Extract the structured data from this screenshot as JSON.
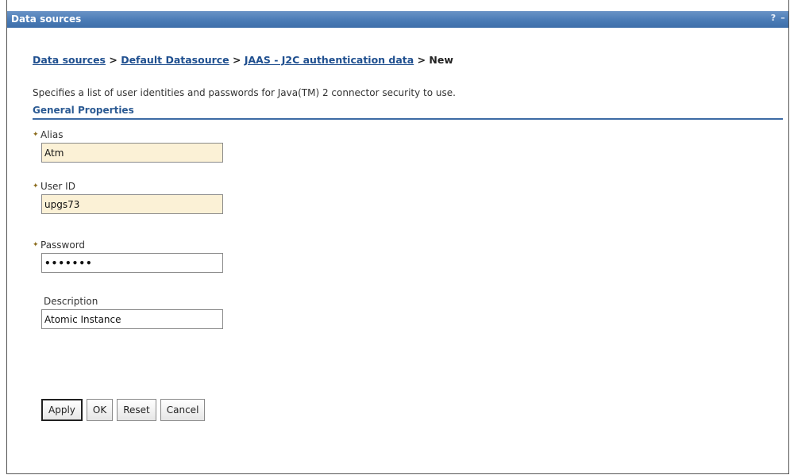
{
  "window": {
    "title": "Data sources",
    "help_icon_glyph": "?",
    "minimize_icon_glyph": "–"
  },
  "breadcrumb": {
    "items": [
      "Data sources",
      "Default Datasource",
      "JAAS - J2C authentication data"
    ],
    "separator": ">",
    "current": "New"
  },
  "description": "Specifies a list of user identities and passwords for Java(TM) 2 connector security to use.",
  "section": {
    "title": "General Properties"
  },
  "form": {
    "alias": {
      "label": "Alias",
      "value": "Atm",
      "required": true
    },
    "user_id": {
      "label": "User ID",
      "value": "upgs73",
      "required": true
    },
    "password": {
      "label": "Password",
      "value": "•••••••",
      "required": true
    },
    "description": {
      "label": "Description",
      "value": "Atomic Instance",
      "required": false
    }
  },
  "buttons": {
    "apply": "Apply",
    "ok": "OK",
    "reset": "Reset",
    "cancel": "Cancel"
  },
  "colors": {
    "title_bar": "#4a7bb6",
    "link": "#1f4f8f",
    "section_rule": "#3c6aa4",
    "required_field_bg": "#fbf1d6"
  }
}
